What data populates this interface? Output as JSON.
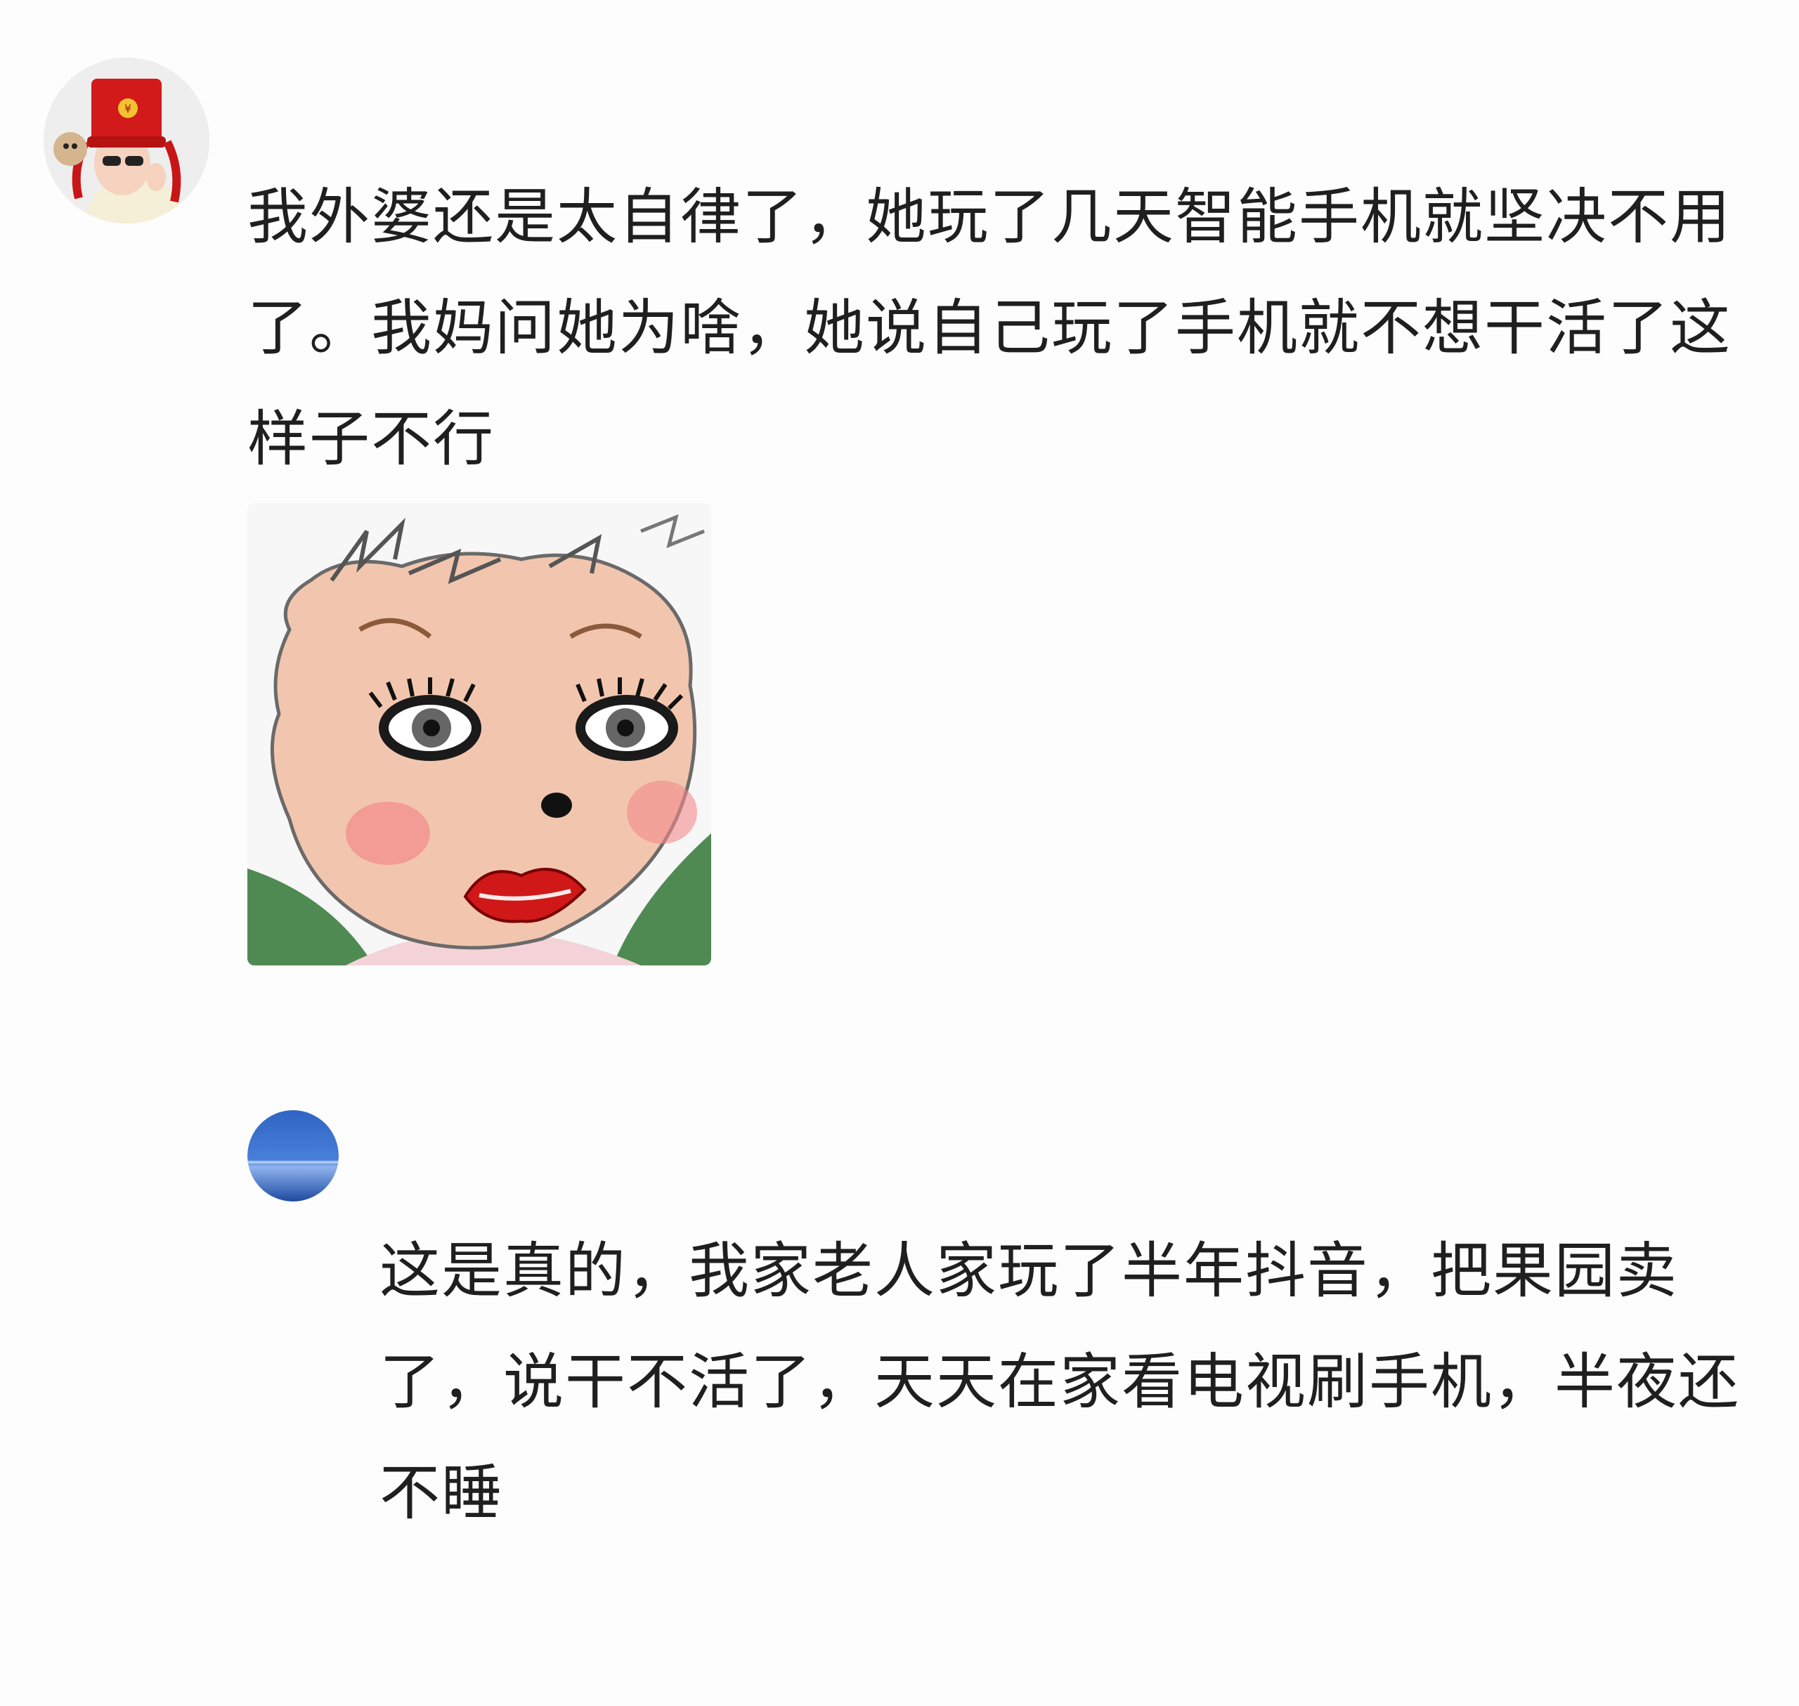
{
  "comments": [
    {
      "text": "我外婆还是太自律了，她玩了几天智能手机就坚决不用了。我妈问她为啥，她说自己玩了手机就不想干活了这样子不行",
      "avatar_icon": "user-avatar-red-hat",
      "sticker_icon": "cartoon-face-meme-sticker"
    },
    {
      "text": "这是真的，我家老人家玩了半年抖音，把果园卖了，说干不活了，天天在家看电视刷手机，半夜还不睡",
      "avatar_icon": "user-avatar-blue-sphere"
    }
  ],
  "colors": {
    "background": "#ffffff",
    "text": "#1f1f1f",
    "avatar_red": "#d21a1a",
    "avatar_blue": "#2f64c4"
  }
}
